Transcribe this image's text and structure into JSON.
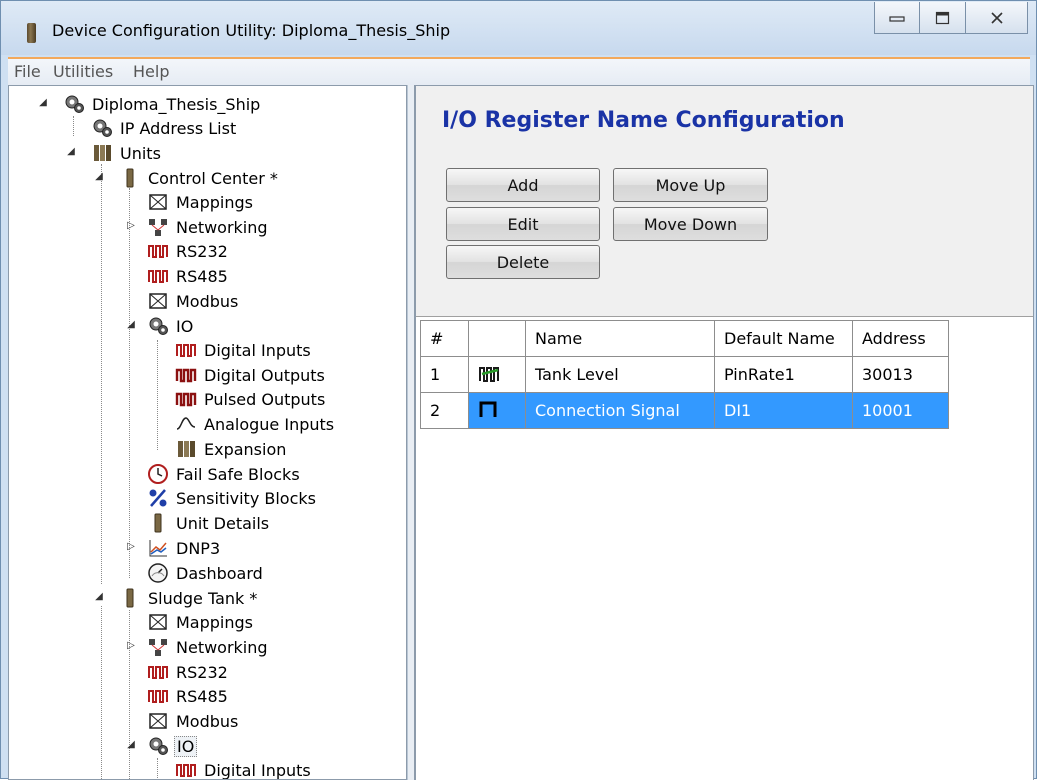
{
  "window": {
    "title": "Device Configuration Utility: Diploma_Thesis_Ship"
  },
  "menu": [
    "File",
    "Utilities",
    "Help"
  ],
  "tree": [
    {
      "label": "Diploma_Thesis_Ship",
      "icon": "gears-icon"
    },
    {
      "label": "IP Address List",
      "icon": "gears-icon"
    },
    {
      "label": "Units",
      "icon": "units-icon"
    },
    {
      "label": "Control Center *",
      "icon": "unit-icon"
    },
    {
      "label": "Mappings",
      "icon": "mappings-icon"
    },
    {
      "label": "Networking",
      "icon": "network-icon"
    },
    {
      "label": "RS232",
      "icon": "serial-icon"
    },
    {
      "label": "RS485",
      "icon": "serial-icon"
    },
    {
      "label": "Modbus",
      "icon": "mappings-icon"
    },
    {
      "label": "IO",
      "icon": "gears-icon"
    },
    {
      "label": "Digital Inputs",
      "icon": "digital-icon"
    },
    {
      "label": "Digital Outputs",
      "icon": "digital-out-icon"
    },
    {
      "label": "Pulsed Outputs",
      "icon": "digital-out-icon"
    },
    {
      "label": "Analogue Inputs",
      "icon": "analog-icon"
    },
    {
      "label": "Expansion",
      "icon": "units-icon"
    },
    {
      "label": "Fail Safe Blocks",
      "icon": "clock-icon"
    },
    {
      "label": "Sensitivity Blocks",
      "icon": "percent-icon"
    },
    {
      "label": "Unit Details",
      "icon": "unit-icon"
    },
    {
      "label": "DNP3",
      "icon": "chart-icon"
    },
    {
      "label": "Dashboard",
      "icon": "dashboard-icon"
    },
    {
      "label": "Sludge Tank *",
      "icon": "unit-icon"
    },
    {
      "label": "Mappings",
      "icon": "mappings-icon"
    },
    {
      "label": "Networking",
      "icon": "network-icon"
    },
    {
      "label": "RS232",
      "icon": "serial-icon"
    },
    {
      "label": "RS485",
      "icon": "serial-icon"
    },
    {
      "label": "Modbus",
      "icon": "mappings-icon"
    },
    {
      "label": "IO",
      "icon": "gears-icon"
    },
    {
      "label": "Digital Inputs",
      "icon": "digital-icon"
    }
  ],
  "panel": {
    "title": "I/O Register  Name Configuration",
    "buttons": {
      "add": "Add",
      "move_up": "Move Up",
      "edit": "Edit",
      "move_down": "Move Down",
      "delete": "Delete"
    }
  },
  "grid": {
    "headers": [
      "#",
      "",
      "Name",
      "Default Name",
      "Address"
    ],
    "rows": [
      {
        "num": "1",
        "icon": "pulse-rate-icon",
        "name": "Tank Level",
        "default_name": "PinRate1",
        "address": "30013"
      },
      {
        "num": "2",
        "icon": "digital-signal-icon",
        "name": "Connection Signal",
        "default_name": "DI1",
        "address": "10001",
        "selected": true
      }
    ]
  },
  "colors": {
    "title_blue": "#1a33a6",
    "selection": "#3399ff",
    "menu_accent": "#f3a95c"
  }
}
